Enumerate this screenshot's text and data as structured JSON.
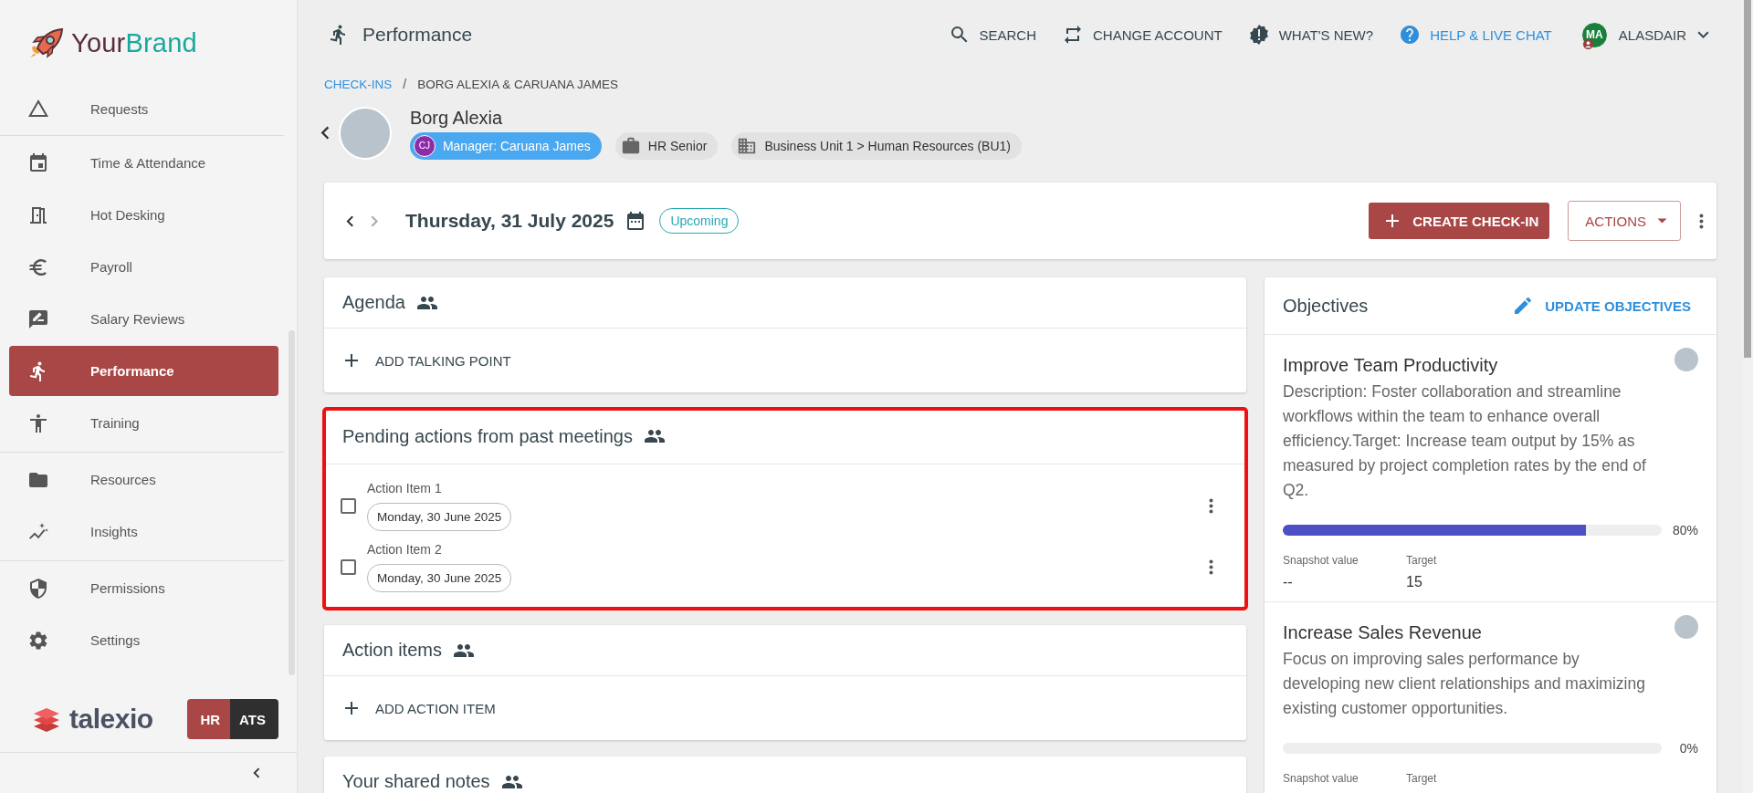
{
  "brand": {
    "name": [
      "Your",
      "Brand"
    ]
  },
  "sidebar": {
    "sections": [
      {
        "items": [
          {
            "label": "Requests",
            "selected": false
          }
        ]
      },
      {
        "items": [
          {
            "label": "Time & Attendance",
            "selected": false
          },
          {
            "label": "Hot Desking",
            "selected": false
          },
          {
            "label": "Payroll",
            "selected": false
          },
          {
            "label": "Salary Reviews",
            "selected": false
          },
          {
            "label": "Performance",
            "selected": true
          },
          {
            "label": "Training",
            "selected": false
          }
        ]
      },
      {
        "items": [
          {
            "label": "Resources",
            "selected": false
          },
          {
            "label": "Insights",
            "selected": false
          }
        ]
      },
      {
        "items": [
          {
            "label": "Permissions",
            "selected": false
          },
          {
            "label": "Settings",
            "selected": false
          }
        ]
      }
    ]
  },
  "footer": {
    "product": "talexio",
    "modules": [
      {
        "label": "HR",
        "selected": true
      },
      {
        "label": "ATS",
        "selected": false
      }
    ]
  },
  "header": {
    "title": "Performance",
    "actions": [
      {
        "label": "SEARCH",
        "accent": false
      },
      {
        "label": "CHANGE ACCOUNT",
        "accent": false
      },
      {
        "label": "WHAT'S NEW?",
        "accent": false
      },
      {
        "label": "HELP & LIVE CHAT",
        "accent": true
      }
    ],
    "user": {
      "initials": "MA",
      "name": "ALASDAIR"
    }
  },
  "breadcrumb": {
    "separator": "/",
    "items": [
      {
        "label": "CHECK-INS",
        "link": true
      },
      {
        "label": "BORG ALEXIA & CARUANA JAMES",
        "link": false
      }
    ]
  },
  "profile": {
    "name": "Borg Alexia",
    "chips": [
      {
        "kind": "manager",
        "initials": "CJ",
        "label": "Manager: Caruana James"
      },
      {
        "kind": "role",
        "label": "HR Senior"
      },
      {
        "kind": "unit",
        "label": "Business Unit 1 > Human Resources (BU1)"
      }
    ]
  },
  "checkin": {
    "date": "Thursday, 31 July 2025",
    "status": "Upcoming",
    "create_label": "CREATE CHECK-IN",
    "actions_label": "ACTIONS"
  },
  "sections": [
    {
      "title": "Agenda",
      "highlighted": false,
      "add_label": "ADD TALKING POINT"
    },
    {
      "title": "Pending actions from past meetings",
      "highlighted": true,
      "items": [
        {
          "label": "Action Item 1",
          "date": "Monday, 30 June 2025",
          "checked": false
        },
        {
          "label": "Action Item 2",
          "date": "Monday, 30 June 2025",
          "checked": false
        }
      ]
    },
    {
      "title": "Action items",
      "highlighted": false,
      "add_label": "ADD ACTION ITEM"
    },
    {
      "title": "Your shared notes",
      "highlighted": false
    }
  ],
  "objectives": {
    "title": "Objectives",
    "update_label": "UPDATE OBJECTIVES",
    "items": [
      {
        "title": "Improve Team Productivity",
        "description": "Description: Foster collaboration and streamline workflows within the team to enhance overall efficiency.Target: Increase team output by 15% as measured by project completion rates by the end of Q2.",
        "level": 0.8,
        "reading": "80%",
        "snapshot_label": "Snapshot value",
        "snapshot_value": "--",
        "target_label": "Target",
        "target_value": "15"
      },
      {
        "title": "Increase Sales Revenue",
        "description": "Focus on improving sales performance by developing new client relationships and maximizing existing customer opportunities.",
        "level": 0,
        "reading": "0%",
        "snapshot_label": "Snapshot value",
        "target_label": "Target"
      }
    ]
  }
}
